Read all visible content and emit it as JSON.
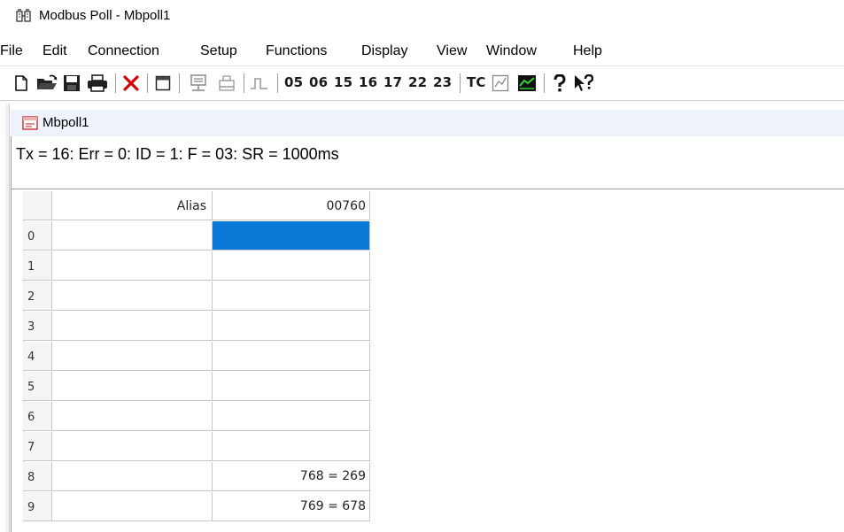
{
  "window": {
    "title": "Modbus Poll - Mbpoll1"
  },
  "menu": {
    "items": [
      "File",
      "Edit",
      "Connection",
      "Setup",
      "Functions",
      "Display",
      "View",
      "Window",
      "Help"
    ]
  },
  "toolbar": {
    "function_codes": [
      "05",
      "06",
      "15",
      "16",
      "17",
      "22",
      "23"
    ],
    "tc_label": "TC",
    "icons": [
      "new-document-icon",
      "open-folder-icon",
      "save-icon",
      "print-icon",
      "delete-icon",
      "window-icon",
      "connect-icon",
      "read-write-icon",
      "pulse-icon",
      "tc-icon",
      "trend-icon",
      "chart-icon",
      "about-icon",
      "context-help-icon"
    ]
  },
  "child_window": {
    "title": "Mbpoll1",
    "status": "Tx = 16: Err = 0: ID = 1: F = 03: SR = 1000ms"
  },
  "grid": {
    "headers": {
      "alias": "Alias",
      "address": "00760"
    },
    "rows": [
      {
        "index": "0",
        "alias": "",
        "value": "",
        "selected": true
      },
      {
        "index": "1",
        "alias": "",
        "value": ""
      },
      {
        "index": "2",
        "alias": "",
        "value": ""
      },
      {
        "index": "3",
        "alias": "",
        "value": ""
      },
      {
        "index": "4",
        "alias": "",
        "value": ""
      },
      {
        "index": "5",
        "alias": "",
        "value": ""
      },
      {
        "index": "6",
        "alias": "",
        "value": ""
      },
      {
        "index": "7",
        "alias": "",
        "value": ""
      },
      {
        "index": "8",
        "alias": "",
        "value": "768 = 269"
      },
      {
        "index": "9",
        "alias": "",
        "value": "769 = 678"
      }
    ]
  },
  "colors": {
    "selection": "#0a78d7",
    "delete_red": "#d40000",
    "child_title_bg": "#eef3fb"
  }
}
